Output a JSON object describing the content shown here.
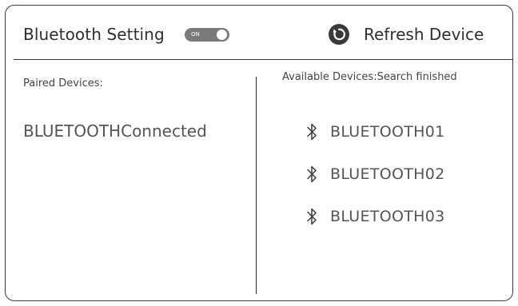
{
  "header": {
    "title": "Bluetooth Setting",
    "toggle": {
      "label": "ON",
      "state": "on"
    },
    "refresh": {
      "label": "Refresh Device",
      "icon": "refresh-icon"
    }
  },
  "paired": {
    "heading": "Paired Devices:",
    "devices": [
      {
        "name": "BLUETOOTHConnected"
      }
    ]
  },
  "available": {
    "heading": "Available Devices:Search finished",
    "devices": [
      {
        "name": "BLUETOOTH01",
        "icon": "bluetooth-icon"
      },
      {
        "name": "BLUETOOTH02",
        "icon": "bluetooth-icon"
      },
      {
        "name": "BLUETOOTH03",
        "icon": "bluetooth-icon"
      }
    ]
  },
  "colors": {
    "text": "#333333",
    "border": "#3a3a3a",
    "toggle_track": "#7a7a7a",
    "icon": "#3a3a3a"
  }
}
